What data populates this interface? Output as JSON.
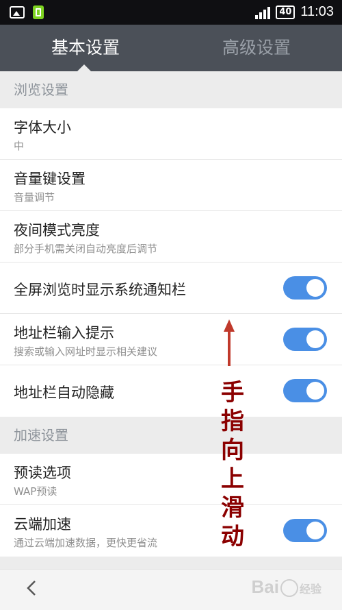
{
  "status_bar": {
    "battery_level": "40",
    "time": "11:03",
    "icons": [
      "gallery-icon",
      "battery-app-icon",
      "signal-icon",
      "battery-icon"
    ]
  },
  "tabs": [
    {
      "label": "基本设置",
      "active": true
    },
    {
      "label": "高级设置",
      "active": false
    }
  ],
  "sections": [
    {
      "header": "浏览设置",
      "items": [
        {
          "title": "字体大小",
          "subtitle": "中",
          "toggle": null
        },
        {
          "title": "音量键设置",
          "subtitle": "音量调节",
          "toggle": null
        },
        {
          "title": "夜间模式亮度",
          "subtitle": "部分手机需关闭自动亮度后调节",
          "toggle": null
        },
        {
          "title": "全屏浏览时显示系统通知栏",
          "subtitle": "",
          "toggle": "on"
        },
        {
          "title": "地址栏输入提示",
          "subtitle": "搜索或输入网址时显示相关建议",
          "toggle": "on"
        },
        {
          "title": "地址栏自动隐藏",
          "subtitle": "",
          "toggle": "on"
        }
      ]
    },
    {
      "header": "加速设置",
      "items": [
        {
          "title": "预读选项",
          "subtitle": "WAP预读",
          "toggle": null
        },
        {
          "title": "云端加速",
          "subtitle": "通过云端加速数据，更快更省流",
          "toggle": "on"
        }
      ]
    }
  ],
  "annotation": {
    "text_chars": [
      "手",
      "指",
      "向",
      "上",
      "滑",
      "动"
    ],
    "color": "#8b0000"
  },
  "nav": {
    "back_icon": "chevron-left-icon",
    "watermark_prefix": "Bai",
    "watermark_suffix": "经验"
  },
  "colors": {
    "toggle_on": "#4a8fe5",
    "tabbar_bg": "#4b5058",
    "section_bg": "#ececec"
  }
}
